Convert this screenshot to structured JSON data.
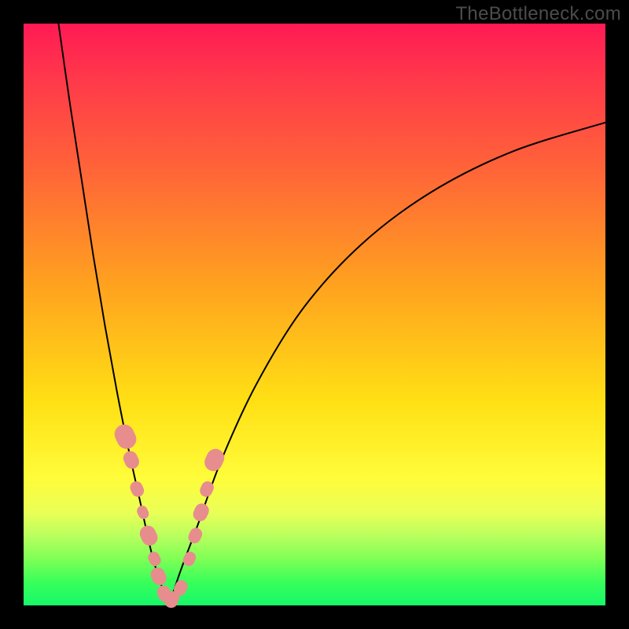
{
  "watermark": "TheBottleneck.com",
  "colors": {
    "frame": "#000000",
    "curve": "#000000",
    "marker_fill": "#e78d8d",
    "marker_stroke": "#d97878"
  },
  "chart_data": {
    "type": "line",
    "title": "",
    "xlabel": "",
    "ylabel": "",
    "xlim": [
      0,
      100
    ],
    "ylim": [
      0,
      100
    ],
    "grid": false,
    "legend": false,
    "note": "Bottleneck-style V curve. x is a normalized hardware-balance axis (0–100); y is bottleneck percentage (0 = no bottleneck at bottom, 100 at top). Values estimated from pixel positions.",
    "series": [
      {
        "name": "left_branch",
        "x": [
          6,
          8,
          10,
          12,
          14,
          16,
          18,
          20,
          22,
          23.5,
          25
        ],
        "y": [
          100,
          86,
          73,
          60,
          48,
          37,
          27,
          18,
          9,
          4,
          0
        ]
      },
      {
        "name": "right_branch",
        "x": [
          25,
          27,
          30,
          34,
          40,
          48,
          58,
          70,
          84,
          100
        ],
        "y": [
          0,
          6,
          14,
          25,
          38,
          51,
          62,
          71,
          78,
          83
        ]
      }
    ],
    "markers": {
      "name": "highlighted_points",
      "note": "Salmon capsule markers clustered near the valley on both branches; sizes vary.",
      "points": [
        {
          "x": 17.5,
          "y": 29,
          "size": 2.2
        },
        {
          "x": 18.5,
          "y": 25,
          "size": 1.6
        },
        {
          "x": 19.5,
          "y": 20,
          "size": 1.4
        },
        {
          "x": 20.5,
          "y": 16,
          "size": 1.2
        },
        {
          "x": 21.5,
          "y": 12,
          "size": 1.8
        },
        {
          "x": 22.5,
          "y": 8,
          "size": 1.3
        },
        {
          "x": 23.2,
          "y": 5,
          "size": 1.6
        },
        {
          "x": 24.2,
          "y": 2,
          "size": 1.5
        },
        {
          "x": 25.5,
          "y": 1,
          "size": 1.5
        },
        {
          "x": 27.0,
          "y": 3,
          "size": 1.4
        },
        {
          "x": 28.5,
          "y": 8,
          "size": 1.3
        },
        {
          "x": 29.5,
          "y": 12,
          "size": 1.4
        },
        {
          "x": 30.5,
          "y": 16,
          "size": 1.6
        },
        {
          "x": 31.5,
          "y": 20,
          "size": 1.4
        },
        {
          "x": 32.8,
          "y": 25,
          "size": 2.0
        }
      ]
    }
  }
}
